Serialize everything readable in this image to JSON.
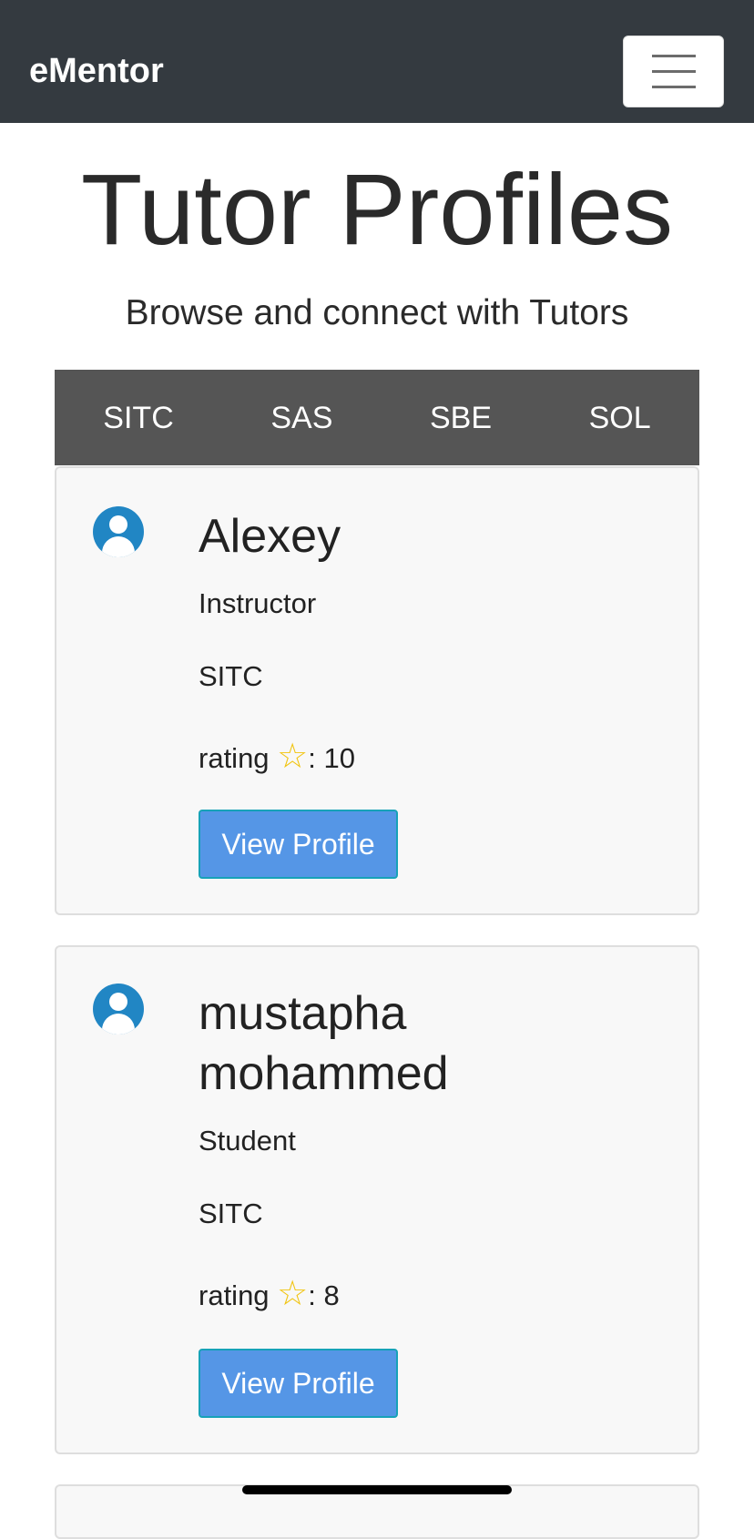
{
  "navbar": {
    "brand": "eMentor",
    "toggle_icon": "hamburger-menu-icon"
  },
  "header": {
    "title": "Tutor Profiles",
    "subtitle": "Browse and connect with Tutors"
  },
  "tabs": [
    {
      "label": "SITC"
    },
    {
      "label": "SAS"
    },
    {
      "label": "SBE"
    },
    {
      "label": "SOL"
    }
  ],
  "tutors": [
    {
      "name": "Alexey",
      "role": "Instructor",
      "school": "SITC",
      "rating_label": "rating",
      "rating_value": ": 10",
      "button_label": "View Profile"
    },
    {
      "name": "mustapha mohammed",
      "role": "Student",
      "school": "SITC",
      "rating_label": "rating",
      "rating_value": ": 8",
      "button_label": "View Profile"
    }
  ],
  "colors": {
    "navbar": "#343a40",
    "tabs": "#555555",
    "button": "#5596e6",
    "avatar": "#2186c4",
    "star": "#f1c40f"
  }
}
